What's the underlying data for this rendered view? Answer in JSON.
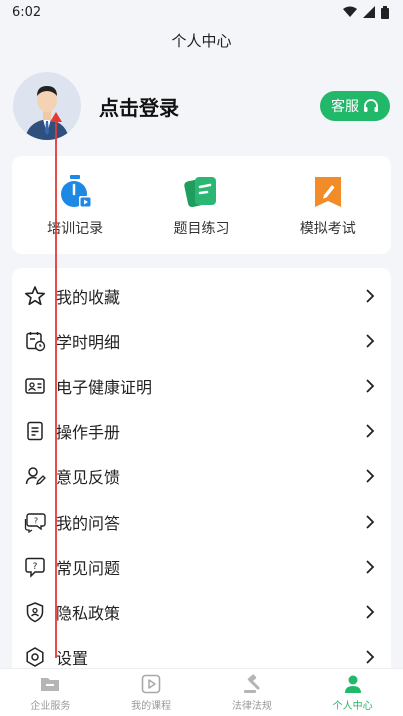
{
  "status": {
    "time": "6:02"
  },
  "header": {
    "title": "个人中心"
  },
  "profile": {
    "login_label": "点击登录",
    "service_label": "客服"
  },
  "quick": [
    {
      "label": "培训记录",
      "icon": "stopwatch-icon"
    },
    {
      "label": "题目练习",
      "icon": "practice-icon"
    },
    {
      "label": "模拟考试",
      "icon": "exam-icon"
    }
  ],
  "menu": [
    {
      "label": "我的收藏",
      "icon": "star-icon"
    },
    {
      "label": "学时明细",
      "icon": "calendar-clock-icon"
    },
    {
      "label": "电子健康证明",
      "icon": "id-card-icon"
    },
    {
      "label": "操作手册",
      "icon": "manual-icon"
    },
    {
      "label": "意见反馈",
      "icon": "feedback-icon"
    },
    {
      "label": "我的问答",
      "icon": "qa-icon"
    },
    {
      "label": "常见问题",
      "icon": "faq-icon"
    },
    {
      "label": "隐私政策",
      "icon": "shield-icon"
    },
    {
      "label": "设置",
      "icon": "gear-icon"
    }
  ],
  "tabs": [
    {
      "label": "企业服务",
      "icon": "folder-icon"
    },
    {
      "label": "我的课程",
      "icon": "play-icon"
    },
    {
      "label": "法律法规",
      "icon": "gavel-icon"
    },
    {
      "label": "个人中心",
      "icon": "person-icon"
    }
  ],
  "colors": {
    "accent": "#22b86a",
    "stopwatch": "#1e88e5",
    "practice": "#2bb673",
    "exam": "#f28c28"
  }
}
